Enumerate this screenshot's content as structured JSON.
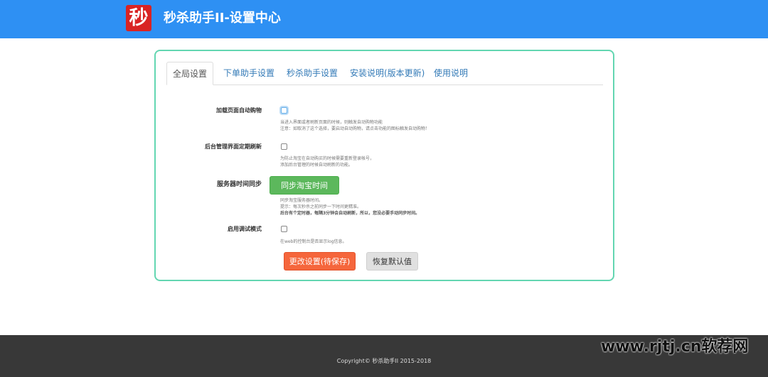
{
  "header": {
    "logo_char": "秒",
    "title": "秒杀助手II-设置中心",
    "bg_color": "#2e90f3"
  },
  "tabs": [
    {
      "label": "全局设置",
      "active": true
    },
    {
      "label": "下单助手设置",
      "active": false
    },
    {
      "label": "秒杀助手设置",
      "active": false
    },
    {
      "label": "安装说明(版本更新)",
      "active": false
    },
    {
      "label": "使用说明",
      "active": false
    }
  ],
  "settings": {
    "auto_buy": {
      "label": "加载页面自动购物",
      "checked": false,
      "help": [
        "当进入界面或者刷新页面的时候，则触发自动购物功能",
        "注意：如取消了这个选择，要启动自动购物，请点击功能的图标触发自动购物！"
      ]
    },
    "backend_refresh": {
      "label": "后台管理界面定期刷新",
      "checked": false,
      "help": [
        "为防止淘宝在自动购买的时候需要重新登录帐号，",
        "添加后台管理的时候自动刷新的功能。"
      ]
    },
    "time_sync": {
      "label": "服务器时间同步",
      "button": "同步淘宝时间",
      "help": [
        "同步淘宝服务器时间。",
        "提示：每次秒杀之前同步一下时间更精准。",
        "后台有个定时器，每隔3分钟会自动刷新，所以，您没必要手动同步时间。"
      ]
    },
    "debug_mode": {
      "label": "启用调试模式",
      "checked": false,
      "help": [
        "在web的控制台是否显示log信息。"
      ]
    }
  },
  "actions": {
    "save_label": "更改设置(待保存)",
    "reset_label": "恢复默认值"
  },
  "footer": {
    "copyright": "Copyright© 秒杀助手II 2015-2018"
  },
  "watermark": "www.rjtj.cn软荐网",
  "colors": {
    "accent": "#2e90f3",
    "panel_border": "#63d6b1",
    "sync_button": "#5cb85c",
    "save_button": "#f5663c",
    "footer": "#383838"
  }
}
